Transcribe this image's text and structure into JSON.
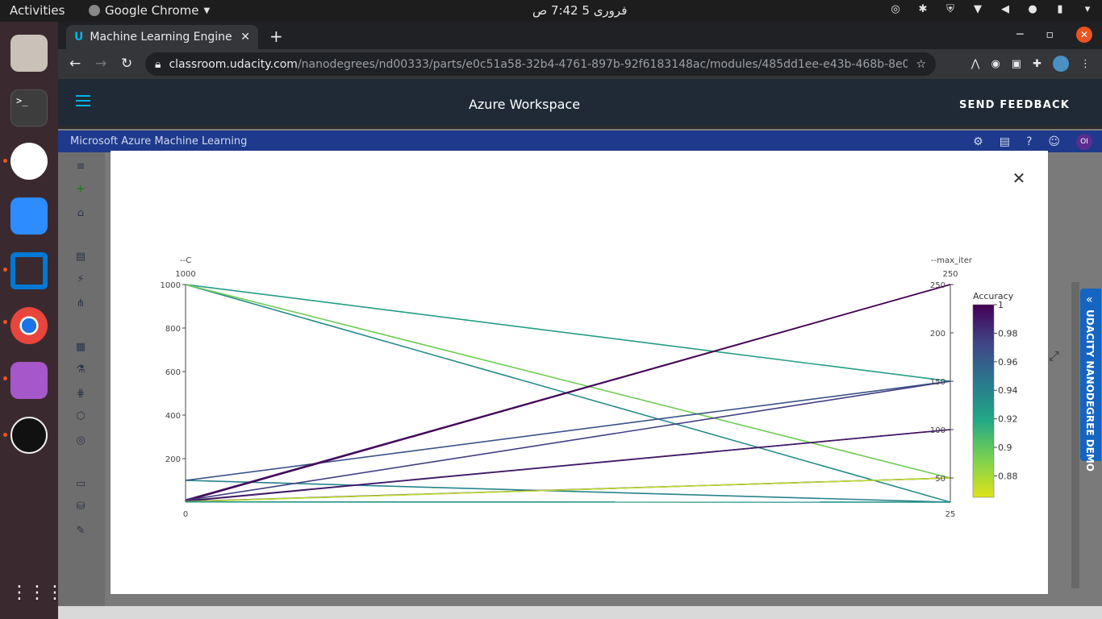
{
  "topbar": {
    "activities": "Activities",
    "app": "Google Chrome",
    "clock": "فروری 5  7:42 ص"
  },
  "browser": {
    "tab_title": "Machine Learning Engine",
    "url_host": "classroom.udacity.com",
    "url_path": "/nanodegrees/nd00333/parts/e0c51a58-32b4-4761-897b-92f6183148ac/modules/485dd1ee-e43b-468b-8e0f-60d9fe6..."
  },
  "udacity": {
    "workspace_title": "Azure Workspace",
    "feedback_label": "SEND FEEDBACK",
    "demo_tab_label": "UDACITY NANODEGREE DEMO"
  },
  "azure": {
    "app_name": "Microsoft Azure Machine Learning",
    "avatar_initials": "OI"
  },
  "chart_data": {
    "type": "parallel_coordinates",
    "dimensions": [
      {
        "label": "--C",
        "range": [
          0,
          1000
        ],
        "top_label": "1000",
        "bottom_label": "0",
        "ticks": [
          200,
          400,
          600,
          800,
          1000
        ]
      },
      {
        "label": "--max_iter",
        "range": [
          25,
          250
        ],
        "top_label": "250",
        "bottom_label": "25",
        "ticks": [
          50,
          100,
          150,
          200,
          250
        ]
      }
    ],
    "colorbar": {
      "title": "Accuracy",
      "min": 0.865,
      "max": 1,
      "ticks": [
        0.88,
        0.9,
        0.92,
        0.94,
        0.96,
        0.98,
        1
      ]
    },
    "lines": [
      {
        "C": 1000,
        "max_iter": 150,
        "accuracy": 0.925
      },
      {
        "C": 1000,
        "max_iter": 25,
        "accuracy": 0.935
      },
      {
        "C": 1000,
        "max_iter": 50,
        "accuracy": 0.895
      },
      {
        "C": 100,
        "max_iter": 25,
        "accuracy": 0.94
      },
      {
        "C": 100,
        "max_iter": 150,
        "accuracy": 0.965
      },
      {
        "C": 10,
        "max_iter": 250,
        "accuracy": 0.99
      },
      {
        "C": 5,
        "max_iter": 250,
        "accuracy": 1.0
      },
      {
        "C": 8,
        "max_iter": 150,
        "accuracy": 0.975
      },
      {
        "C": 6,
        "max_iter": 100,
        "accuracy": 0.985
      },
      {
        "C": 4,
        "max_iter": 100,
        "accuracy": 0.99
      },
      {
        "C": 3,
        "max_iter": 50,
        "accuracy": 0.995
      },
      {
        "C": 2,
        "max_iter": 50,
        "accuracy": 0.875
      },
      {
        "C": 1,
        "max_iter": 25,
        "accuracy": 0.93
      }
    ]
  }
}
